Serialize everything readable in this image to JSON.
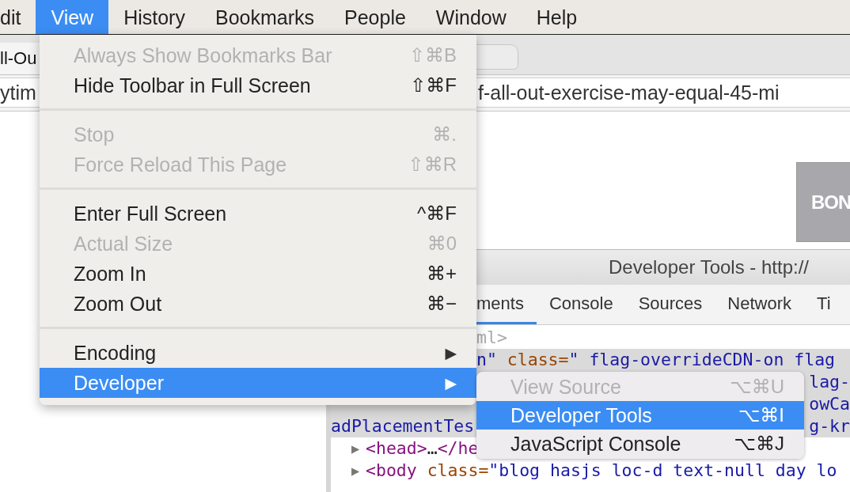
{
  "menu_bar": [
    {
      "label": "dit",
      "selected": false
    },
    {
      "label": "View",
      "selected": true
    },
    {
      "label": "History",
      "selected": false
    },
    {
      "label": "Bookmarks",
      "selected": false
    },
    {
      "label": "People",
      "selected": false
    },
    {
      "label": "Window",
      "selected": false
    },
    {
      "label": "Help",
      "selected": false
    }
  ],
  "tabs": [
    {
      "label": "ll-Ou",
      "selected": true
    },
    {
      "selected": false
    }
  ],
  "address_bar": {
    "start": "ytim",
    "end": "f-all-out-exercise-may-equal-45-mi"
  },
  "page": {
    "ad_text": "BON"
  },
  "devtools": {
    "title": "Developer Tools - http://",
    "tabs": [
      {
        "label": "ments",
        "selected": true
      },
      {
        "label": "Console",
        "selected": false
      },
      {
        "label": "Sources",
        "selected": false
      },
      {
        "label": "Network",
        "selected": false
      },
      {
        "label": "Ti",
        "selected": false
      }
    ],
    "lines": [
      {
        "selected": false,
        "after_menu": [
          {
            "kind": "faded",
            "text": "ml>"
          }
        ]
      },
      {
        "selected": true,
        "after_menu": [
          {
            "kind": "value",
            "text": "n\""
          },
          {
            "kind": "attr",
            "text": " class="
          },
          {
            "kind": "value",
            "text": "\" flag-overrideCDN-on flag"
          }
        ]
      },
      {
        "selected": true,
        "end": [
          {
            "kind": "value",
            "text": "lag-"
          }
        ]
      },
      {
        "selected": true,
        "end": [
          {
            "kind": "value",
            "text": "owCa"
          }
        ]
      },
      {
        "selected": true,
        "start": [
          {
            "kind": "value",
            "text": "adPlacementTes"
          }
        ],
        "end": [
          {
            "kind": "value",
            "text": "g-kr"
          }
        ]
      },
      {
        "selected": false,
        "toggle": "▶",
        "start": [
          {
            "kind": "tag",
            "text": "<head>"
          },
          {
            "kind": "text",
            "text": "…"
          },
          {
            "kind": "tag",
            "text": "</he"
          }
        ]
      },
      {
        "selected": false,
        "toggle": "▶",
        "start": [
          {
            "kind": "tag",
            "text": "<body"
          },
          {
            "kind": "attr",
            "text": " class="
          },
          {
            "kind": "value",
            "text": "\"blog hasjs loc-d text-null day lo"
          }
        ]
      }
    ]
  },
  "view_menu": {
    "items": [
      {
        "kind": "item",
        "label": "Always Show Bookmarks Bar",
        "shortcut": "⇧⌘B",
        "disabled": true,
        "selected": false
      },
      {
        "kind": "item",
        "label": "Hide Toolbar in Full Screen",
        "shortcut": "⇧⌘F",
        "disabled": false,
        "selected": false
      },
      {
        "kind": "separator"
      },
      {
        "kind": "item",
        "label": "Stop",
        "shortcut": "⌘.",
        "disabled": true,
        "selected": false
      },
      {
        "kind": "item",
        "label": "Force Reload This Page",
        "shortcut": "⇧⌘R",
        "disabled": true,
        "selected": false
      },
      {
        "kind": "separator"
      },
      {
        "kind": "item",
        "label": "Enter Full Screen",
        "shortcut": "^⌘F",
        "disabled": false,
        "selected": false
      },
      {
        "kind": "item",
        "label": "Actual Size",
        "shortcut": "⌘0",
        "disabled": true,
        "selected": false
      },
      {
        "kind": "item",
        "label": "Zoom In",
        "shortcut": "⌘+",
        "disabled": false,
        "selected": false
      },
      {
        "kind": "item",
        "label": "Zoom Out",
        "shortcut": "⌘−",
        "disabled": false,
        "selected": false
      },
      {
        "kind": "separator"
      },
      {
        "kind": "submenu",
        "label": "Encoding",
        "arrow": "▶",
        "disabled": false,
        "selected": false
      },
      {
        "kind": "submenu",
        "label": "Developer",
        "arrow": "▶",
        "disabled": false,
        "selected": true
      }
    ]
  },
  "developer_submenu": {
    "items": [
      {
        "kind": "item",
        "label": "View Source",
        "shortcut": "⌥⌘U",
        "disabled": true,
        "selected": false
      },
      {
        "kind": "item",
        "label": "Developer Tools",
        "shortcut": "⌥⌘I",
        "disabled": false,
        "selected": true
      },
      {
        "kind": "item",
        "label": "JavaScript Console",
        "shortcut": "⌥⌘J",
        "disabled": false,
        "selected": false
      }
    ]
  }
}
